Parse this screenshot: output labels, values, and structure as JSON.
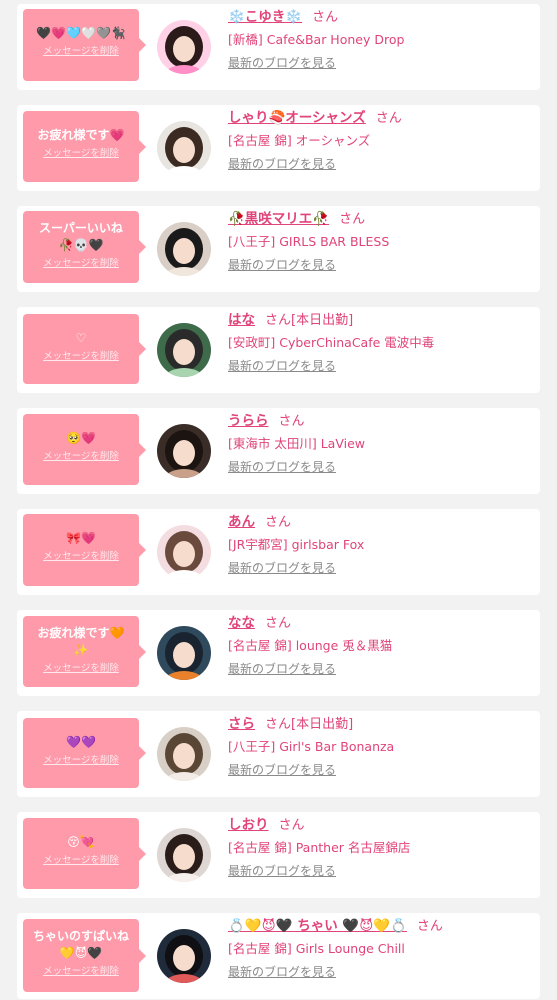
{
  "colors": {
    "accent": "#e0447a",
    "bubble": "#ff9aaa",
    "muted": "#8a8a8a"
  },
  "rows": [
    {
      "name": "❄️こゆき❄️",
      "san": "さん",
      "badge": "",
      "shop": "[新橋] Cafe&Bar Honey Drop",
      "blog": "最新のブログを見る",
      "message": "🖤💗🩵🤍🩶🐈‍⬛",
      "delete": "メッセージを削除",
      "avatar_colors": [
        "#ffd1e6",
        "#ff8fc6",
        "#2b1a1a"
      ]
    },
    {
      "name": "しゃり🍣オーシャンズ",
      "san": "さん",
      "badge": "",
      "shop": "[名古屋 錦] オーシャンズ",
      "blog": "最新のブログを見る",
      "message": "お疲れ様です💗",
      "delete": "メッセージを削除",
      "avatar_colors": [
        "#e8e4e0",
        "#ffffff",
        "#3a2a22"
      ]
    },
    {
      "name": "🥀黒咲マリエ🥀",
      "san": "さん",
      "badge": "",
      "shop": "[八王子] GIRLS BAR BLESS",
      "blog": "最新のブログを見る",
      "message": "スーパーいいね\n🥀💀🖤",
      "delete": "メッセージを削除",
      "avatar_colors": [
        "#d9cfc7",
        "#f1e6dc",
        "#1a1a1a"
      ]
    },
    {
      "name": "はな",
      "san": "さん",
      "badge": "[本日出勤]",
      "shop": "[安政町] CyberChinaCafe 電波中毒",
      "blog": "最新のブログを見る",
      "message": "♡",
      "delete": "メッセージを削除",
      "avatar_colors": [
        "#3e6b4a",
        "#a8d5b0",
        "#2a2a2a"
      ]
    },
    {
      "name": "うらら",
      "san": "さん",
      "badge": "",
      "shop": "[東海市 太田川] LaView",
      "blog": "最新のブログを見る",
      "message": "🥺💗",
      "delete": "メッセージを削除",
      "avatar_colors": [
        "#3a2c26",
        "#c9a08a",
        "#1c1410"
      ]
    },
    {
      "name": "あん",
      "san": "さん",
      "badge": "",
      "shop": "[JR宇都宮] girlsbar Fox",
      "blog": "最新のブログを見る",
      "message": "🎀💗",
      "delete": "メッセージを削除",
      "avatar_colors": [
        "#f4dde0",
        "#ffffff",
        "#6b4a3e"
      ]
    },
    {
      "name": "なな",
      "san": "さん",
      "badge": "",
      "shop": "[名古屋 錦] lounge 兎＆黒猫",
      "blog": "最新のブログを見る",
      "message": "お疲れ様です🧡\n✨",
      "delete": "メッセージを削除",
      "avatar_colors": [
        "#2f4a5c",
        "#e8802c",
        "#1a2330"
      ]
    },
    {
      "name": "さら",
      "san": "さん",
      "badge": "[本日出勤]",
      "shop": "[八王子] Girl's Bar Bonanza",
      "blog": "最新のブログを見る",
      "message": "💜💜",
      "delete": "メッセージを削除",
      "avatar_colors": [
        "#d8cfc6",
        "#f3ece6",
        "#5a4634"
      ]
    },
    {
      "name": "しおり",
      "san": "さん",
      "badge": "",
      "shop": "[名古屋 錦] Panther 名古屋錦店",
      "blog": "最新のブログを見る",
      "message": "😚💘",
      "delete": "メッセージを削除",
      "avatar_colors": [
        "#ddd6d2",
        "#f6efec",
        "#2a1c18"
      ]
    },
    {
      "name": "💍💛😈🖤 ちゃい 🖤😈💛💍",
      "san": "さん",
      "badge": "",
      "shop": "[名古屋 錦] Girls Lounge Chill",
      "blog": "最新のブログを見る",
      "message": "ちゃいのすぱいね\n💛😈🖤",
      "delete": "メッセージを削除",
      "avatar_colors": [
        "#1f2a3a",
        "#e05a5a",
        "#0f0f14"
      ]
    }
  ]
}
